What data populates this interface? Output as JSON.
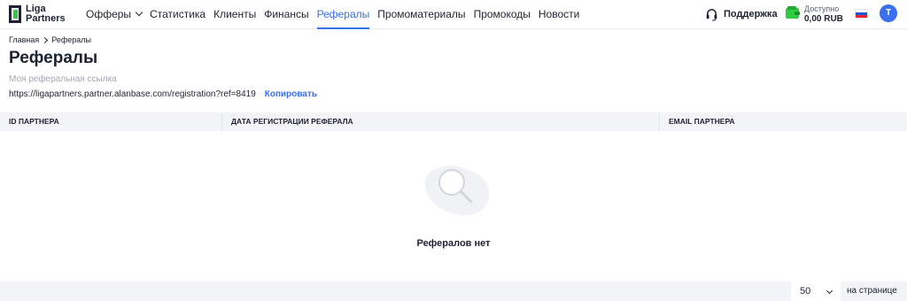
{
  "brand": {
    "line1": "Liga",
    "line2": "Partners",
    "accent": "#2ecc40"
  },
  "nav": {
    "items": [
      {
        "label": "Офферы"
      },
      {
        "label": "Статистика"
      },
      {
        "label": "Клиенты"
      },
      {
        "label": "Финансы"
      },
      {
        "label": "Рефералы",
        "active": true
      },
      {
        "label": "Промоматериалы"
      },
      {
        "label": "Промокоды"
      },
      {
        "label": "Новости"
      }
    ]
  },
  "header": {
    "support_label": "Поддержка",
    "balance_label": "Доступно",
    "balance_value": "0,00 RUB",
    "avatar_initial": "T",
    "language_flag": "ru"
  },
  "breadcrumb": {
    "home": "Главная",
    "current": "Рефералы"
  },
  "page": {
    "title": "Рефералы",
    "ref_label": "Моя реферальная ссылка",
    "ref_url": "https://ligapartners.partner.alanbase.com/registration?ref=8419",
    "copy_label": "Копировать"
  },
  "table": {
    "columns": [
      "ID ПАРТНЕРА",
      "ДАТА РЕГИСТРАЦИИ РЕФЕРАЛА",
      "EMAIL ПАРТНЕРА"
    ],
    "rows": [],
    "empty_text": "Рефералов нет"
  },
  "pagination": {
    "per_page": "50",
    "per_page_label": "на странице"
  },
  "colors": {
    "accent": "#3a6ff0",
    "header_bg": "#f3f4f7",
    "wallet": "#2ecc40"
  }
}
